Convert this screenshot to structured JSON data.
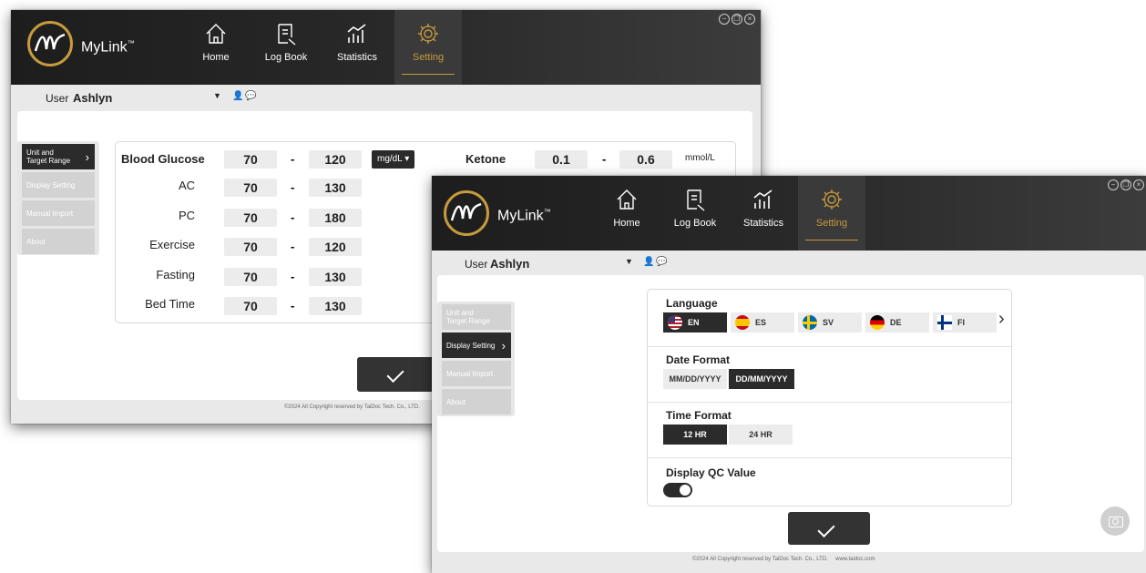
{
  "brand": {
    "name": "MyLink",
    "tm": "™",
    "accent": "#c79a3c"
  },
  "nav": [
    {
      "label": "Home",
      "icon": "home-icon"
    },
    {
      "label": "Log Book",
      "icon": "logbook-icon"
    },
    {
      "label": "Statistics",
      "icon": "statistics-icon"
    },
    {
      "label": "Setting",
      "icon": "gear-icon"
    }
  ],
  "user": {
    "label": "User",
    "name": "Ashlyn"
  },
  "sidebar": [
    {
      "label_line1": "Unit and",
      "label_line2": "Target Range"
    },
    {
      "label": "Display Setting"
    },
    {
      "label": "Manual Import"
    },
    {
      "label": "About"
    }
  ],
  "targets": {
    "glucose_label": "Blood Glucose",
    "glucose_min": "70",
    "glucose_max": "120",
    "glucose_unit": "mg/dL",
    "rows": [
      {
        "label": "AC",
        "min": "70",
        "max": "130"
      },
      {
        "label": "PC",
        "min": "70",
        "max": "180"
      },
      {
        "label": "Exercise",
        "min": "70",
        "max": "120"
      },
      {
        "label": "Fasting",
        "min": "70",
        "max": "130"
      },
      {
        "label": "Bed Time",
        "min": "70",
        "max": "130"
      }
    ],
    "dash": "-",
    "ketone_label": "Ketone",
    "ketone_min": "0.1",
    "ketone_max": "0.6",
    "ketone_unit": "mmol/L"
  },
  "display": {
    "language_title": "Language",
    "languages": [
      "EN",
      "ES",
      "SV",
      "DE",
      "FI"
    ],
    "date_title": "Date Format",
    "date_options": [
      "MM/DD/YYYY",
      "DD/MM/YYYY"
    ],
    "time_title": "Time Format",
    "time_options": [
      "12 HR",
      "24 HR"
    ],
    "qc_title": "Display QC Value"
  },
  "footer1": "©2024 All Copyright reserved by TaiDoc Tech. Co., LTD.",
  "footer2": "©2024 All Copyright reserved by TaiDoc Tech. Co., LTD.     www.taidoc.com"
}
